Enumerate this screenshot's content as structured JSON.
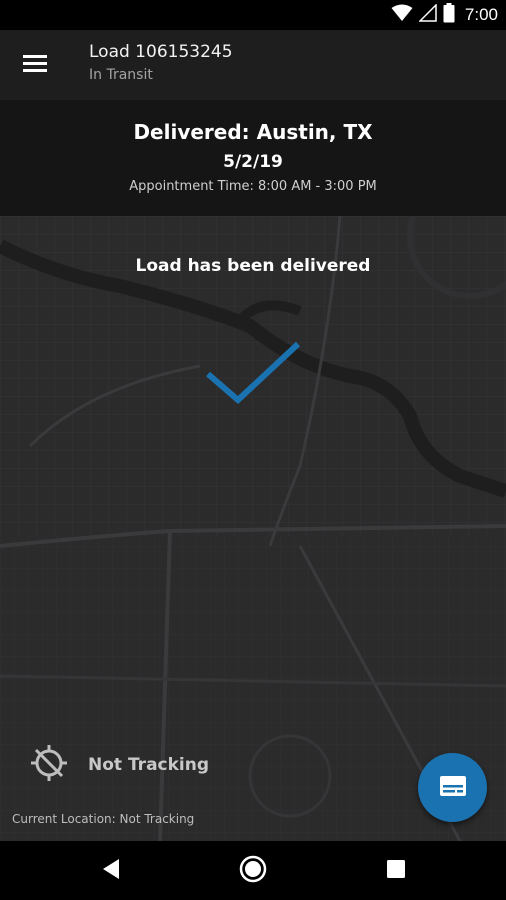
{
  "status_bar": {
    "time": "7:00",
    "icons": [
      "wifi-icon",
      "signal-icon",
      "battery-icon"
    ]
  },
  "app_bar": {
    "title": "Load 106153245",
    "subtitle": "In Transit",
    "menu_icon": "menu-icon"
  },
  "delivery": {
    "title": "Delivered: Austin, TX",
    "date": "5/2/19",
    "appointment": "Appointment Time: 8:00 AM - 3:00 PM"
  },
  "map": {
    "message": "Load has been delivered",
    "check_icon": "checkmark-icon",
    "check_color": "#1a72b0"
  },
  "tracking": {
    "label": "Not Tracking",
    "icon": "location-off-icon",
    "current_location": "Current Location: Not Tracking"
  },
  "fab": {
    "icon": "message-card-icon",
    "color": "#1a72b0"
  },
  "nav_bar": {
    "icons": [
      "back-icon",
      "home-icon",
      "recents-icon"
    ]
  }
}
